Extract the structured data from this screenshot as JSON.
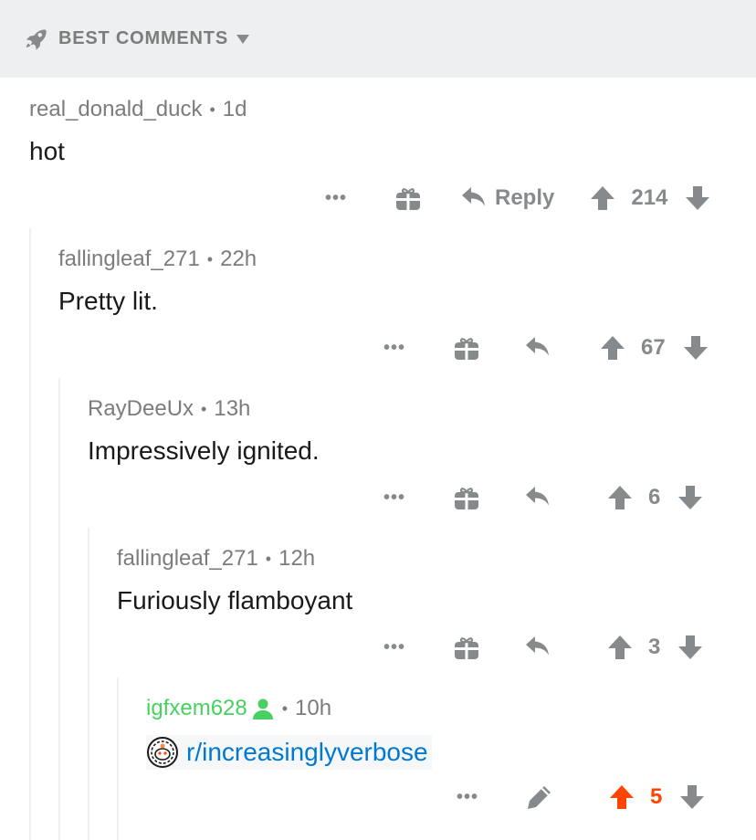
{
  "sort": {
    "label": "BEST COMMENTS",
    "icon": "rocket-icon"
  },
  "comments": [
    {
      "author": "real_donald_duck",
      "time": "1d",
      "body": "hot",
      "reply_label": "Reply",
      "score": "214"
    },
    {
      "author": "fallingleaf_271",
      "time": "22h",
      "body": "Pretty lit.",
      "score": "67"
    },
    {
      "author": "RayDeeUx",
      "time": "13h",
      "body": "Impressively ignited.",
      "score": "6"
    },
    {
      "author": "fallingleaf_271",
      "time": "12h",
      "body": "Furiously flamboyant",
      "score": "3"
    },
    {
      "author": "igfxem628",
      "time": "10h",
      "link": "r/increasinglyverbose",
      "score": "5",
      "upvoted": true
    }
  ],
  "colors": {
    "accent_upvote": "#ff4500",
    "link": "#0079d3",
    "mod_green": "#46d160",
    "muted": "#878a8c"
  },
  "separator": "•"
}
